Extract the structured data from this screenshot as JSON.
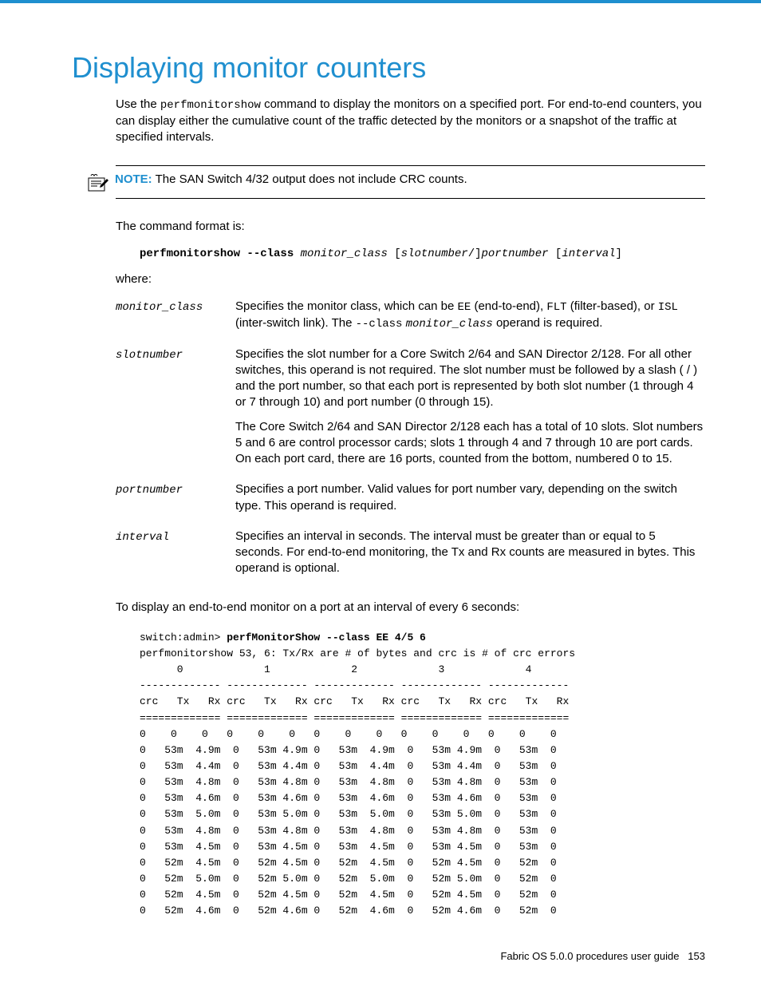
{
  "title": "Displaying monitor counters",
  "intro_parts": {
    "p1": "Use the ",
    "cmd": "perfmonitorshow",
    "p2": " command to display the monitors on a specified port. For end-to-end counters, you can display either the cumulative count of the traffic detected by the monitors or a snapshot of the traffic at specified intervals."
  },
  "note": {
    "label": "NOTE:",
    "text": " The SAN Switch 4/32 output does not include CRC counts."
  },
  "command_format_label": "The command format is:",
  "command_syntax": {
    "bold": "perfmonitorshow --class",
    "italic1": " monitor_class ",
    "brack1": "[",
    "italic2": "slotnumber",
    "slash": "/]",
    "italic3": "portnumber ",
    "brack2": "[",
    "italic4": "interval",
    "brack3": "]"
  },
  "where_label": "where:",
  "params": {
    "monitor_class": {
      "term": "monitor_class",
      "desc_p1": "Specifies the monitor class, which can be ",
      "code_ee": "EE",
      "desc_p2": " (end-to-end), ",
      "code_flt": "FLT",
      "desc_p3": " (filter-based), or ",
      "code_isl": "ISL",
      "desc_p4": " (inter-switch link). The ",
      "code_class": "--class",
      "space": " ",
      "ital_mc": "monitor_class",
      "desc_p5": " operand is required."
    },
    "slotnumber": {
      "term": "slotnumber",
      "desc1": "Specifies the slot number for a Core Switch 2/64 and SAN Director 2/128. For all other switches, this operand is not required. The slot number must be followed by a slash ( / ) and the port number, so that each port is represented by both slot number (1 through 4 or 7 through 10) and port number (0 through 15).",
      "desc2": "The Core Switch 2/64 and SAN Director 2/128 each has a total of 10 slots. Slot numbers 5 and 6 are control processor cards; slots 1 through 4 and 7 through 10 are port cards. On each port card, there are 16 ports, counted from the bottom, numbered 0 to 15."
    },
    "portnumber": {
      "term": "portnumber",
      "desc": "Specifies a port number. Valid values for port number vary, depending on the switch type. This operand is required."
    },
    "interval": {
      "term": "interval",
      "desc": "Specifies an interval in seconds. The interval must be greater than or equal to 5 seconds. For end-to-end monitoring, the Tx and Rx counts are measured in bytes. This operand is optional."
    }
  },
  "display_sentence": "To display an end-to-end monitor on a port at an interval of every 6 seconds:",
  "code_lines": [
    {
      "prefix": "switch:admin> ",
      "bold": "perfMonitorShow --class EE 4/5 6"
    },
    {
      "text": "perfmonitorshow 53, 6: Tx/Rx are # of bytes and crc is # of crc errors"
    },
    {
      "text": "      0             1             2             3             4"
    },
    {
      "text": "------------- ------------- ------------- ------------- -------------"
    },
    {
      "text": "crc   Tx   Rx crc   Tx   Rx crc   Tx   Rx crc   Tx   Rx crc   Tx   Rx"
    },
    {
      "text": "============= ============= ============= ============= ============="
    },
    {
      "text": "0    0    0   0    0    0   0    0    0   0    0    0   0    0    0"
    },
    {
      "text": "0   53m  4.9m  0   53m 4.9m 0   53m  4.9m  0   53m 4.9m  0   53m  0"
    },
    {
      "text": "0   53m  4.4m  0   53m 4.4m 0   53m  4.4m  0   53m 4.4m  0   53m  0"
    },
    {
      "text": "0   53m  4.8m  0   53m 4.8m 0   53m  4.8m  0   53m 4.8m  0   53m  0"
    },
    {
      "text": "0   53m  4.6m  0   53m 4.6m 0   53m  4.6m  0   53m 4.6m  0   53m  0"
    },
    {
      "text": "0   53m  5.0m  0   53m 5.0m 0   53m  5.0m  0   53m 5.0m  0   53m  0"
    },
    {
      "text": "0   53m  4.8m  0   53m 4.8m 0   53m  4.8m  0   53m 4.8m  0   53m  0"
    },
    {
      "text": "0   53m  4.5m  0   53m 4.5m 0   53m  4.5m  0   53m 4.5m  0   53m  0"
    },
    {
      "text": "0   52m  4.5m  0   52m 4.5m 0   52m  4.5m  0   52m 4.5m  0   52m  0"
    },
    {
      "text": "0   52m  5.0m  0   52m 5.0m 0   52m  5.0m  0   52m 5.0m  0   52m  0"
    },
    {
      "text": "0   52m  4.5m  0   52m 4.5m 0   52m  4.5m  0   52m 4.5m  0   52m  0"
    },
    {
      "text": "0   52m  4.6m  0   52m 4.6m 0   52m  4.6m  0   52m 4.6m  0   52m  0"
    }
  ],
  "footer": {
    "guide": "Fabric OS 5.0.0 procedures user guide",
    "page": "153"
  }
}
